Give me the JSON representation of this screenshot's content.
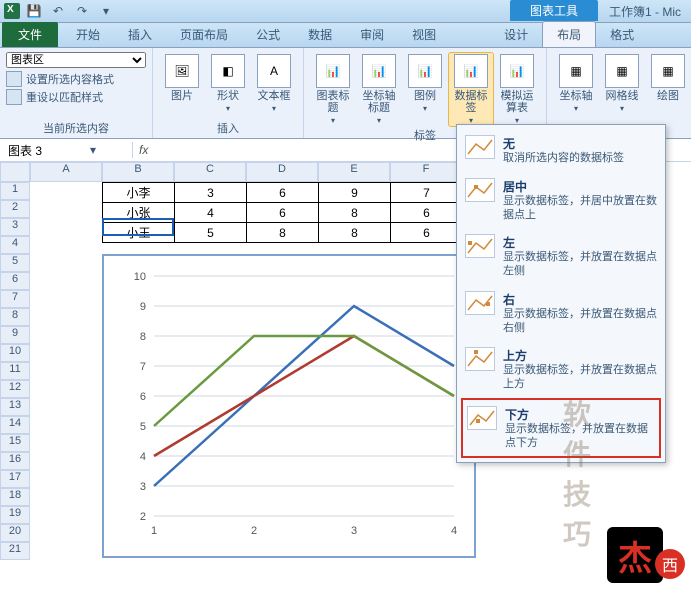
{
  "title": {
    "chart_tools": "图表工具",
    "workbook": "工作簿1 - Mic"
  },
  "tabs": {
    "file": "文件",
    "home": "开始",
    "insert": "插入",
    "page_layout": "页面布局",
    "formulas": "公式",
    "data": "数据",
    "review": "审阅",
    "view": "视图",
    "design": "设计",
    "layout": "布局",
    "format": "格式"
  },
  "ribbon": {
    "selection": {
      "combo": "图表区",
      "set_fmt": "设置所选内容格式",
      "reset": "重设以匹配样式",
      "group": "当前所选内容"
    },
    "insert_group": {
      "picture": "图片",
      "shapes": "形状",
      "textbox": "文本框",
      "group": "插入"
    },
    "labels_group": {
      "chart_title": "图表标题",
      "axis_titles": "坐标轴标题",
      "legend": "图例",
      "data_labels": "数据标签",
      "data_table": "模拟运算表",
      "group": "标签"
    },
    "axes_group": {
      "axes": "坐标轴",
      "gridlines": "网格线",
      "plot": "绘图"
    }
  },
  "namebox": "图表 3",
  "cols": [
    "A",
    "B",
    "C",
    "D",
    "E",
    "F"
  ],
  "rows": [
    "1",
    "2",
    "3",
    "4",
    "5",
    "6",
    "7",
    "8",
    "9",
    "10",
    "11",
    "12",
    "13",
    "14",
    "15",
    "16",
    "17",
    "18",
    "19",
    "20",
    "21"
  ],
  "table": {
    "r1": {
      "B": "小李",
      "C": "3",
      "D": "6",
      "E": "9",
      "F": "7"
    },
    "r2": {
      "B": "小张",
      "C": "4",
      "D": "6",
      "E": "8",
      "F": "6"
    },
    "r3": {
      "B": "小王",
      "C": "5",
      "D": "8",
      "E": "8",
      "F": "6"
    }
  },
  "dropdown": {
    "none": {
      "t": "无",
      "d": "取消所选内容的数据标签"
    },
    "center": {
      "t": "居中",
      "d": "显示数据标签，并居中放置在数据点上"
    },
    "left": {
      "t": "左",
      "d": "显示数据标签，并放置在数据点左侧"
    },
    "right": {
      "t": "右",
      "d": "显示数据标签，并放置在数据点右侧"
    },
    "above": {
      "t": "上方",
      "d": "显示数据标签，并放置在数据点上方"
    },
    "below": {
      "t": "下方",
      "d": "显示数据标签，并放置在数据点下方"
    }
  },
  "chart_data": {
    "type": "line",
    "categories": [
      "1",
      "2",
      "3",
      "4"
    ],
    "series": [
      {
        "name": "小李",
        "values": [
          3,
          6,
          9,
          7
        ],
        "color": "#3a6fb7"
      },
      {
        "name": "小张",
        "values": [
          4,
          6,
          8,
          6
        ],
        "color": "#b03a2e"
      },
      {
        "name": "小王",
        "values": [
          5,
          8,
          8,
          6
        ],
        "color": "#6a9a3e"
      }
    ],
    "ylim": [
      2,
      10
    ],
    "xlabel": "",
    "ylabel": "",
    "title": ""
  },
  "watermark": {
    "text": "软件技巧",
    "logo": "杰",
    "xi": "西"
  }
}
